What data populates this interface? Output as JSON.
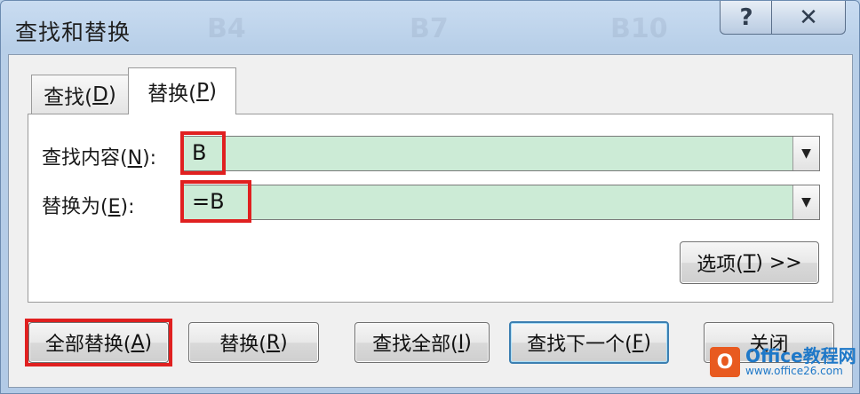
{
  "window": {
    "title": "查找和替换",
    "help_label": "?",
    "close_label": "✕",
    "background_cells": [
      "B4",
      "B7",
      "B10"
    ]
  },
  "tabs": [
    {
      "label_prefix": "查找(",
      "mnemonic": "D",
      "label_suffix": ")",
      "active": false
    },
    {
      "label_prefix": "替换(",
      "mnemonic": "P",
      "label_suffix": ")",
      "active": true
    }
  ],
  "find": {
    "label_prefix": "查找内容(",
    "mnemonic": "N",
    "label_suffix": "):",
    "value": "B"
  },
  "replace": {
    "label_prefix": "替换为(",
    "mnemonic": "E",
    "label_suffix": "):",
    "value": "=B"
  },
  "options_button": {
    "label_prefix": "选项(",
    "mnemonic": "T",
    "label_suffix": ") >>"
  },
  "buttons": {
    "replace_all": {
      "label_prefix": "全部替换(",
      "mnemonic": "A",
      "label_suffix": ")"
    },
    "replace": {
      "label_prefix": "替换(",
      "mnemonic": "R",
      "label_suffix": ")"
    },
    "find_all": {
      "label_prefix": "查找全部(",
      "mnemonic": "I",
      "label_suffix": ")"
    },
    "find_next": {
      "label_prefix": "查找下一个(",
      "mnemonic": "F",
      "label_suffix": ")"
    },
    "close": {
      "label": "关闭"
    }
  },
  "watermark": {
    "logo_letter": "O",
    "brand": "Office教程网",
    "url": "www.office26.com"
  },
  "colors": {
    "highlight": "#e02020",
    "field_fill": "#ccebd6",
    "default_button_border": "#3c7fb1"
  }
}
